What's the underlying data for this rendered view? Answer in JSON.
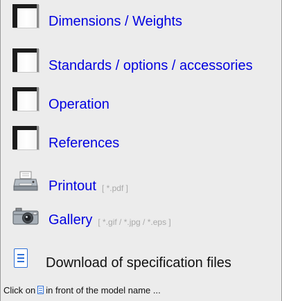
{
  "links": [
    {
      "label": "Dimensions / Weights",
      "icon": "page-icon"
    },
    {
      "label": "Standards / options / accessories",
      "icon": "page-icon"
    },
    {
      "label": "Operation",
      "icon": "page-icon"
    },
    {
      "label": "References",
      "icon": "page-icon"
    }
  ],
  "printout": {
    "label": "Printout",
    "hint": "[ *.pdf ]",
    "icon": "printer-icon"
  },
  "gallery": {
    "label": "Gallery",
    "hint": "[ *.gif / *.jpg / *.eps ]",
    "icon": "camera-icon"
  },
  "download": {
    "label": "Download of specification files",
    "icon": "document-icon"
  },
  "footer": {
    "prefix": "Click on",
    "suffix": "in front of the model name ..."
  },
  "colors": {
    "link": "#0000e0",
    "hint": "#a9a9a9",
    "background": "#ececec",
    "doc_accent": "#2d6fd6"
  }
}
